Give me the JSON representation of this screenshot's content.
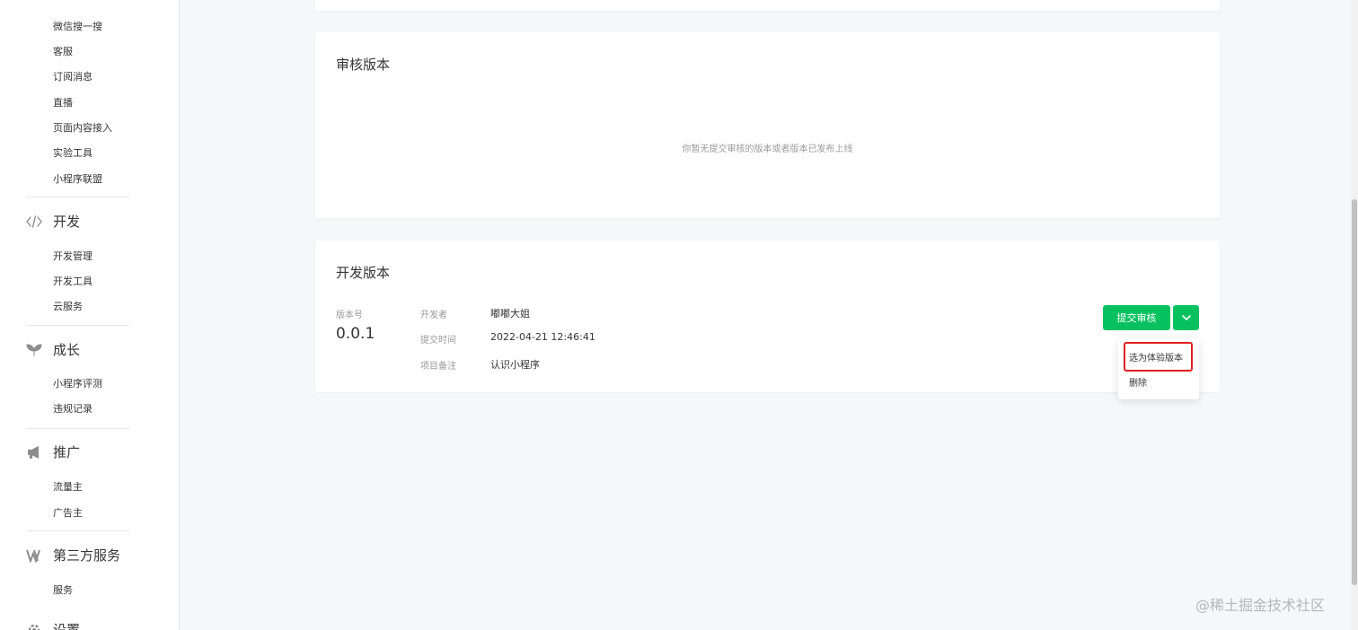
{
  "sidebar": {
    "top_items": [
      "微信搜一搜",
      "客服",
      "订阅消息",
      "直播",
      "页面内容接入",
      "实验工具",
      "小程序联盟"
    ],
    "groups": [
      {
        "icon": "code-icon",
        "title": "开发",
        "items": [
          "开发管理",
          "开发工具",
          "云服务"
        ]
      },
      {
        "icon": "sprout-icon",
        "title": "成长",
        "items": [
          "小程序评测",
          "违规记录"
        ]
      },
      {
        "icon": "megaphone-icon",
        "title": "推广",
        "items": [
          "流量主",
          "广告主"
        ]
      },
      {
        "icon": "third-party-icon",
        "title": "第三方服务",
        "items": [
          "服务"
        ]
      },
      {
        "icon": "gear-icon",
        "title": "设置"
      }
    ]
  },
  "review_card": {
    "title": "审核版本",
    "empty_text": "你暂无提交审核的版本或者版本已发布上线"
  },
  "dev_card": {
    "title": "开发版本",
    "version_label": "版本号",
    "version_value": "0.0.1",
    "developer_label": "开发者",
    "developer_value": "嘟嘟大姐",
    "submit_time_label": "提交时间",
    "submit_time_value": "2022-04-21 12:46:41",
    "remark_label": "项目备注",
    "remark_value": "认识小程序",
    "submit_button": "提交审核",
    "dropdown_icon": "chevron-down-icon"
  },
  "dropdown_menu": {
    "items": [
      "选为体验版本",
      "删除"
    ]
  },
  "watermark": "@稀土掘金技术社区",
  "colors": {
    "primary": "#07c160",
    "highlight": "#e02020",
    "page_bg": "#f6f7f9"
  }
}
